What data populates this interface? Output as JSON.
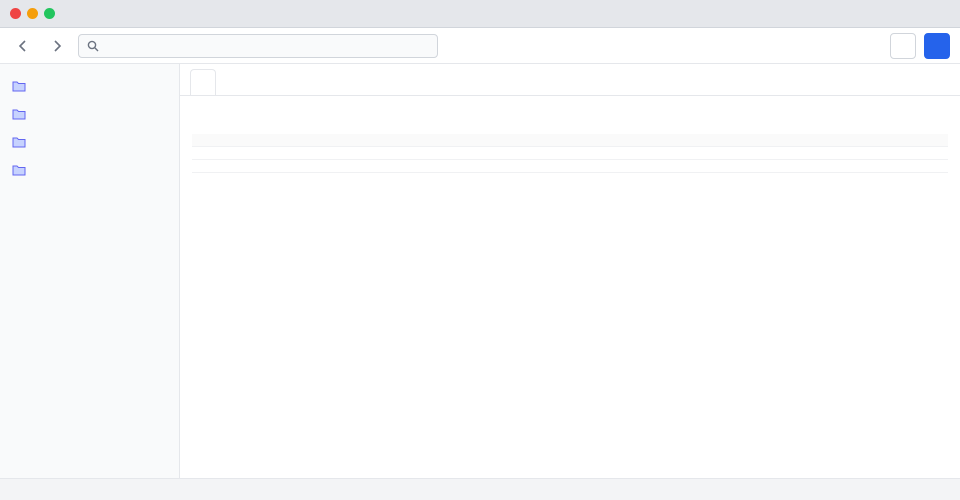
{
  "window": {
    "title": ""
  },
  "toolbar": {
    "search_placeholder": "",
    "search_value": "",
    "secondary_label": "",
    "primary_label": ""
  },
  "sidebar": {
    "items": [
      {
        "label": ""
      },
      {
        "label": ""
      },
      {
        "label": ""
      },
      {
        "label": ""
      }
    ]
  },
  "main": {
    "tabs": [
      {
        "label": ""
      },
      {
        "label": ""
      }
    ],
    "title": "",
    "table": {
      "columns": [
        "",
        "",
        ""
      ],
      "rows": [
        [
          "",
          "",
          ""
        ],
        [
          "",
          "",
          ""
        ]
      ]
    }
  },
  "status": {
    "text": ""
  }
}
